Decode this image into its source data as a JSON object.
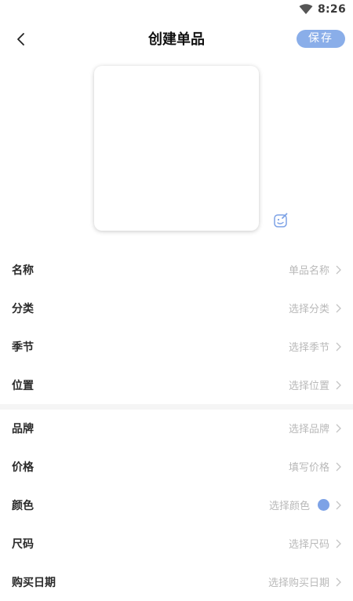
{
  "status_bar": {
    "time": "8:26",
    "wifi_icon": "wifi-icon"
  },
  "nav": {
    "title": "创建单品",
    "save_label": "保存",
    "back_icon": "back-chevron-icon"
  },
  "image": {
    "edit_icon": "edit-image-icon"
  },
  "form": {
    "name": {
      "label": "名称",
      "placeholder": "单品名称"
    },
    "category": {
      "label": "分类",
      "placeholder": "选择分类"
    },
    "season": {
      "label": "季节",
      "placeholder": "选择季节"
    },
    "location": {
      "label": "位置",
      "placeholder": "选择位置"
    },
    "brand": {
      "label": "品牌",
      "placeholder": "选择品牌"
    },
    "price": {
      "label": "价格",
      "placeholder": "填写价格"
    },
    "color": {
      "label": "颜色",
      "placeholder": "选择颜色",
      "swatch": "#7da2e6"
    },
    "size": {
      "label": "尺码",
      "placeholder": "选择尺码"
    },
    "purchase_date": {
      "label": "购买日期",
      "placeholder": "选择购买日期"
    }
  },
  "colors": {
    "accent": "#8aaee9",
    "placeholder": "#b9b9b9"
  }
}
